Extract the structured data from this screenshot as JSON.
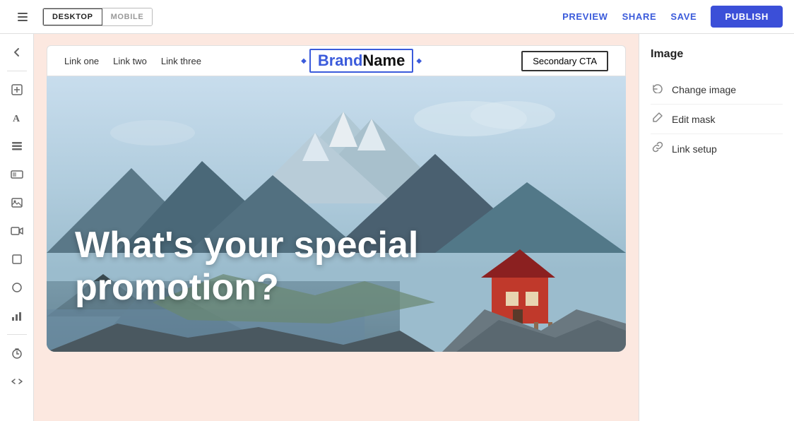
{
  "topBar": {
    "backIcon": "←",
    "deviceOptions": [
      {
        "label": "DESKTOP",
        "active": true
      },
      {
        "label": "MOBILE",
        "active": false
      }
    ],
    "previewLabel": "PREVIEW",
    "shareLabel": "SHARE",
    "saveLabel": "SAVE",
    "publishLabel": "PUBLISH"
  },
  "leftSidebar": {
    "icons": [
      {
        "name": "back-icon",
        "symbol": "↩"
      },
      {
        "name": "add-section-icon",
        "symbol": "⊞"
      },
      {
        "name": "text-icon",
        "symbol": "A"
      },
      {
        "name": "rows-icon",
        "symbol": "☰"
      },
      {
        "name": "media-icon",
        "symbol": "⬛"
      },
      {
        "name": "image-icon",
        "symbol": "🖼"
      },
      {
        "name": "video-icon",
        "symbol": "▶"
      },
      {
        "name": "box-icon",
        "symbol": "□"
      },
      {
        "name": "circle-icon",
        "symbol": "○"
      },
      {
        "name": "chart-icon",
        "symbol": "⣿"
      },
      {
        "name": "divider-icon",
        "symbol": "⋯"
      },
      {
        "name": "timer-icon",
        "symbol": "⏱"
      },
      {
        "name": "code-icon",
        "symbol": "⟨⟩"
      }
    ]
  },
  "canvas": {
    "navbar": {
      "links": [
        "Link one",
        "Link two",
        "Link three"
      ],
      "brandText": "BrandName",
      "brandHighlight": "Brand",
      "ctaLabel": "Secondary CTA"
    },
    "hero": {
      "text": "What's your special promotion?"
    }
  },
  "rightPanel": {
    "title": "Image",
    "items": [
      {
        "icon": "↻",
        "label": "Change image"
      },
      {
        "icon": "↰",
        "label": "Edit mask"
      },
      {
        "icon": "🔗",
        "label": "Link setup"
      }
    ]
  }
}
